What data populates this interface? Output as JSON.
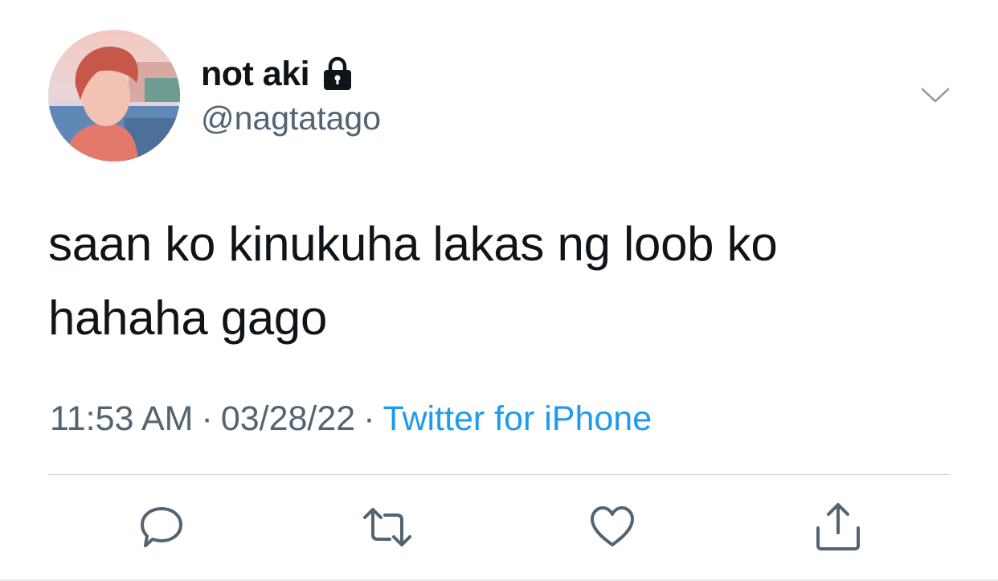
{
  "tweet": {
    "display_name": "not aki",
    "handle": "@nagtatago",
    "text": "saan ko kinukuha lakas ng loob ko hahaha gago",
    "time": "11:53 AM",
    "date": "03/28/22",
    "separator": "·",
    "source": "Twitter for iPhone",
    "protected": true
  },
  "icons": {
    "lock": "lock-icon",
    "more": "chevron-down-icon",
    "reply": "reply-icon",
    "retweet": "retweet-icon",
    "like": "heart-icon",
    "share": "share-icon"
  },
  "colors": {
    "text": "#0f1419",
    "secondary": "#536471",
    "accent": "#1d9bf0",
    "divider": "#cfd9de"
  }
}
